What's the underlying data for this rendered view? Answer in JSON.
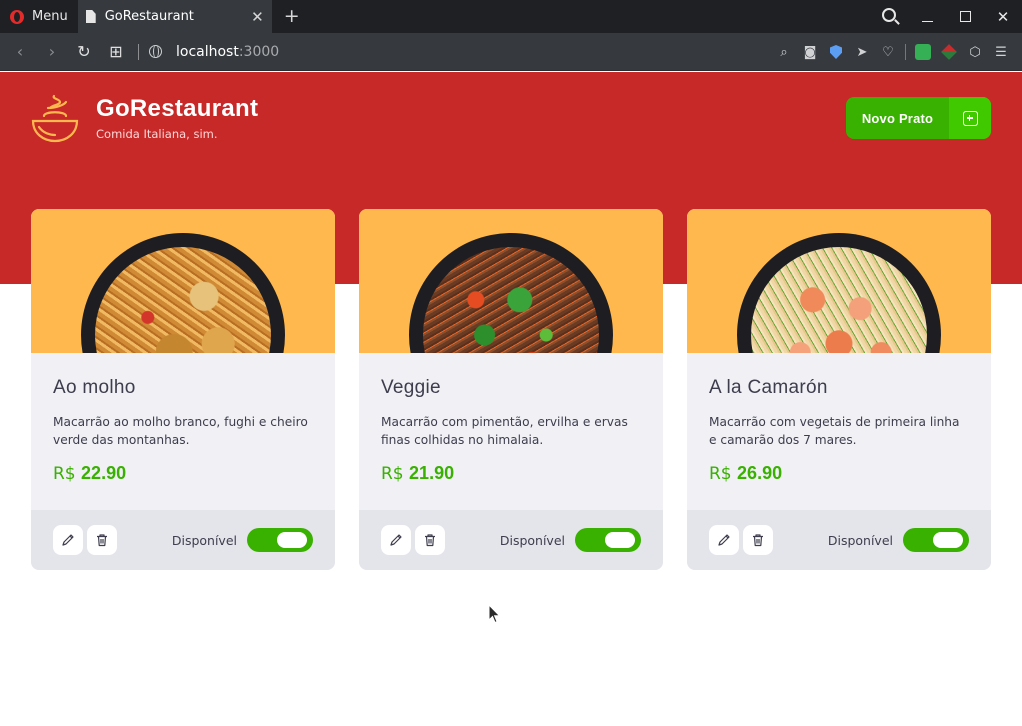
{
  "browser": {
    "menu_label": "Menu",
    "tab_title": "GoRestaurant",
    "url_host": "localhost",
    "url_port": ":3000"
  },
  "header": {
    "brand": "GoRestaurant",
    "tagline": "Comida Italiana, sim.",
    "new_button_label": "Novo Prato"
  },
  "colors": {
    "hero": "#c72828",
    "accent_green": "#39b100",
    "card_image_bg": "#ffb84d"
  },
  "foods": [
    {
      "name": "Ao molho",
      "description": "Macarrão ao molho branco, fughi e cheiro verde das montanhas.",
      "currency": "R$",
      "price": "22.90",
      "available_label": "Disponível",
      "available": true
    },
    {
      "name": "Veggie",
      "description": "Macarrão com pimentão, ervilha e ervas finas colhidas no himalaia.",
      "currency": "R$",
      "price": "21.90",
      "available_label": "Disponível",
      "available": true
    },
    {
      "name": "A la Camarón",
      "description": "Macarrão com vegetais de primeira linha e camarão dos 7 mares.",
      "currency": "R$",
      "price": "26.90",
      "available_label": "Disponível",
      "available": true
    }
  ]
}
